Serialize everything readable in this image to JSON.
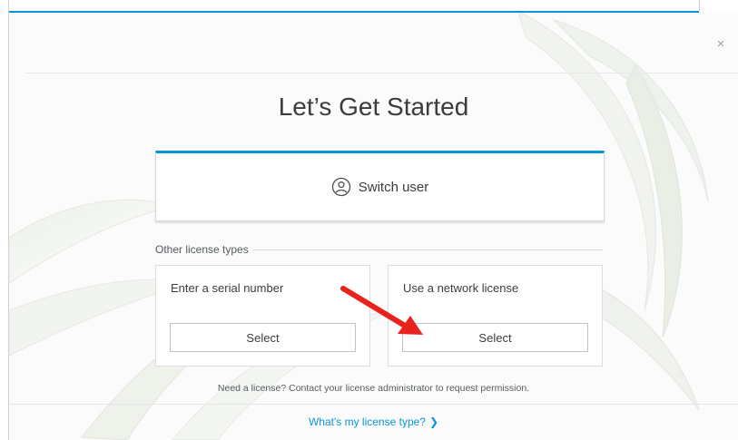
{
  "dialog": {
    "title": "Let’s Get Started",
    "close_symbol": "×",
    "switch_user": {
      "label": "Switch user",
      "icon": "user-circle-icon"
    },
    "other_license_types_label": "Other license types",
    "options": [
      {
        "title": "Enter a serial number",
        "button_label": "Select"
      },
      {
        "title": "Use a network license",
        "button_label": "Select"
      }
    ],
    "note": "Need a license? Contact your license administrator to request permission.",
    "license_link": {
      "label": "What's my license type?",
      "chevron": "❯"
    }
  },
  "colors": {
    "accent": "#0696d7",
    "text": "#3c3c3c",
    "annotation_arrow": "#e8231e"
  }
}
